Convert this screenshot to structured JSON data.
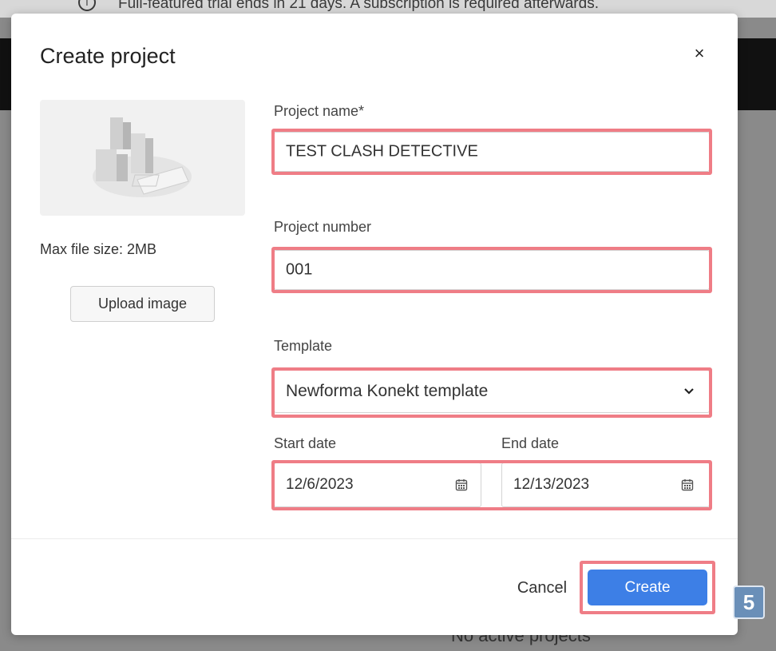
{
  "background": {
    "banner_text": "Full-featured trial ends in 21 days. A subscription is required afterwards.",
    "footer_text": "No active projects"
  },
  "modal": {
    "title": "Create project",
    "close_label": "×",
    "image_panel": {
      "max_size_text": "Max file size: 2MB",
      "upload_label": "Upload image"
    },
    "project_name": {
      "label": "Project name*",
      "value": "TEST CLASH DETECTIVE"
    },
    "project_number": {
      "label": "Project number",
      "value": "001"
    },
    "template": {
      "label": "Template",
      "value": "Newforma Konekt template"
    },
    "start_date": {
      "label": "Start date",
      "value": "12/6/2023"
    },
    "end_date": {
      "label": "End date",
      "value": "12/13/2023"
    },
    "cancel_label": "Cancel",
    "create_label": "Create"
  },
  "step_badge": "5",
  "colors": {
    "accent": "#3d7fe6",
    "highlight": "#ef7d86",
    "badge": "#6a8fb8"
  },
  "icons": {
    "close": "close-icon",
    "calendar": "calendar-icon",
    "chevron": "chevron-down-icon",
    "info": "info-icon"
  }
}
